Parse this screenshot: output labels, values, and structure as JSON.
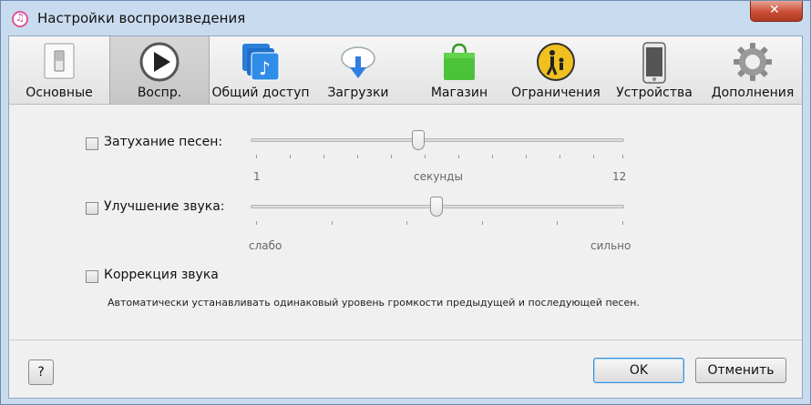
{
  "window": {
    "title": "Настройки воспроизведения"
  },
  "toolbar": {
    "tabs": [
      {
        "label": "Основные",
        "icon": "switch-icon"
      },
      {
        "label": "Воспр.",
        "icon": "play-icon",
        "active": true
      },
      {
        "label": "Общий доступ",
        "icon": "sharing-icon"
      },
      {
        "label": "Загрузки",
        "icon": "download-cloud-icon"
      },
      {
        "label": "Магазин",
        "icon": "store-bag-icon"
      },
      {
        "label": "Ограничения",
        "icon": "parental-icon"
      },
      {
        "label": "Устройства",
        "icon": "iphone-icon"
      },
      {
        "label": "Дополнения",
        "icon": "gear-icon"
      }
    ]
  },
  "crossfade": {
    "label": "Затухание песен:",
    "checked": false,
    "min_label": "1",
    "mid_label": "секунды",
    "max_label": "12",
    "value": 6
  },
  "enhancer": {
    "label": "Улучшение звука:",
    "checked": false,
    "min_label": "слабо",
    "max_label": "сильно",
    "level": 0.5
  },
  "soundcheck": {
    "label": "Коррекция звука",
    "checked": false,
    "description": "Автоматически устанавливать одинаковый уровень громкости предыдущей и последующей песен."
  },
  "buttons": {
    "help": "?",
    "ok": "OK",
    "cancel": "Отменить"
  }
}
